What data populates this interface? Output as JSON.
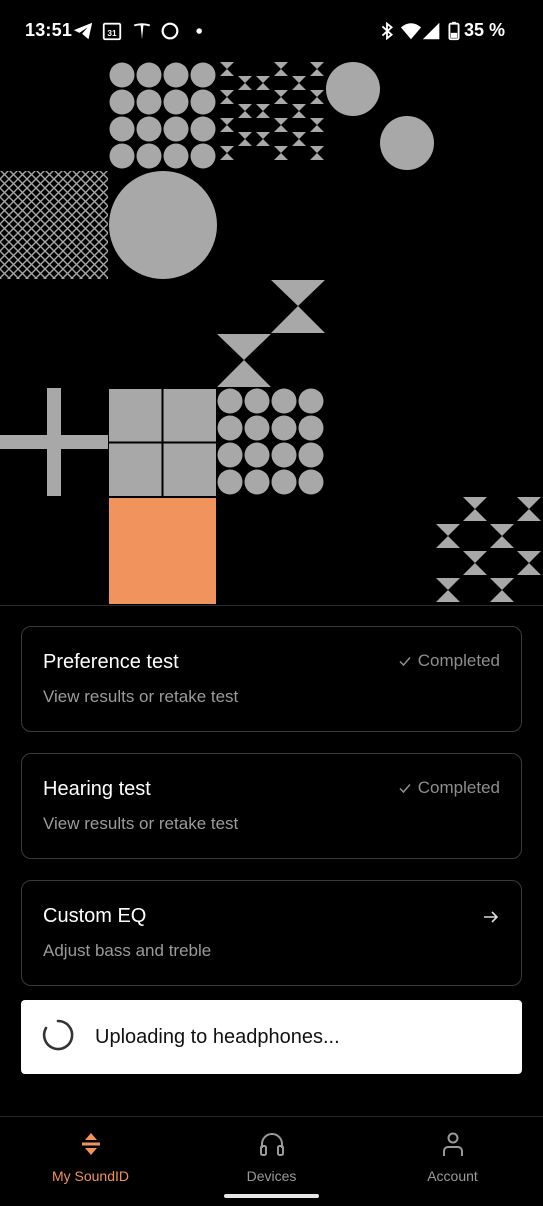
{
  "status_bar": {
    "time": "13:51",
    "battery": "35 %",
    "icons": [
      "telegram-icon",
      "calendar-icon",
      "tesla-icon",
      "circle-icon",
      "dot-icon",
      "bluetooth-icon",
      "wifi-icon",
      "signal-icon",
      "battery-icon"
    ],
    "calendar_day": "31"
  },
  "colors": {
    "accent": "#F0935C",
    "shape_gray": "#A8A8A8",
    "card_border": "#3A3A3A"
  },
  "cards": [
    {
      "title": "Preference test",
      "subtitle": "View results or retake test",
      "status": "Completed"
    },
    {
      "title": "Hearing test",
      "subtitle": "View results or retake test",
      "status": "Completed"
    },
    {
      "title": "Custom EQ",
      "subtitle": "Adjust bass and treble"
    }
  ],
  "toast": {
    "text": "Uploading to headphones..."
  },
  "nav": {
    "items": [
      {
        "label": "My SoundID",
        "icon": "soundid-icon",
        "active": true
      },
      {
        "label": "Devices",
        "icon": "headphones-icon",
        "active": false
      },
      {
        "label": "Account",
        "icon": "person-icon",
        "active": false
      }
    ]
  }
}
